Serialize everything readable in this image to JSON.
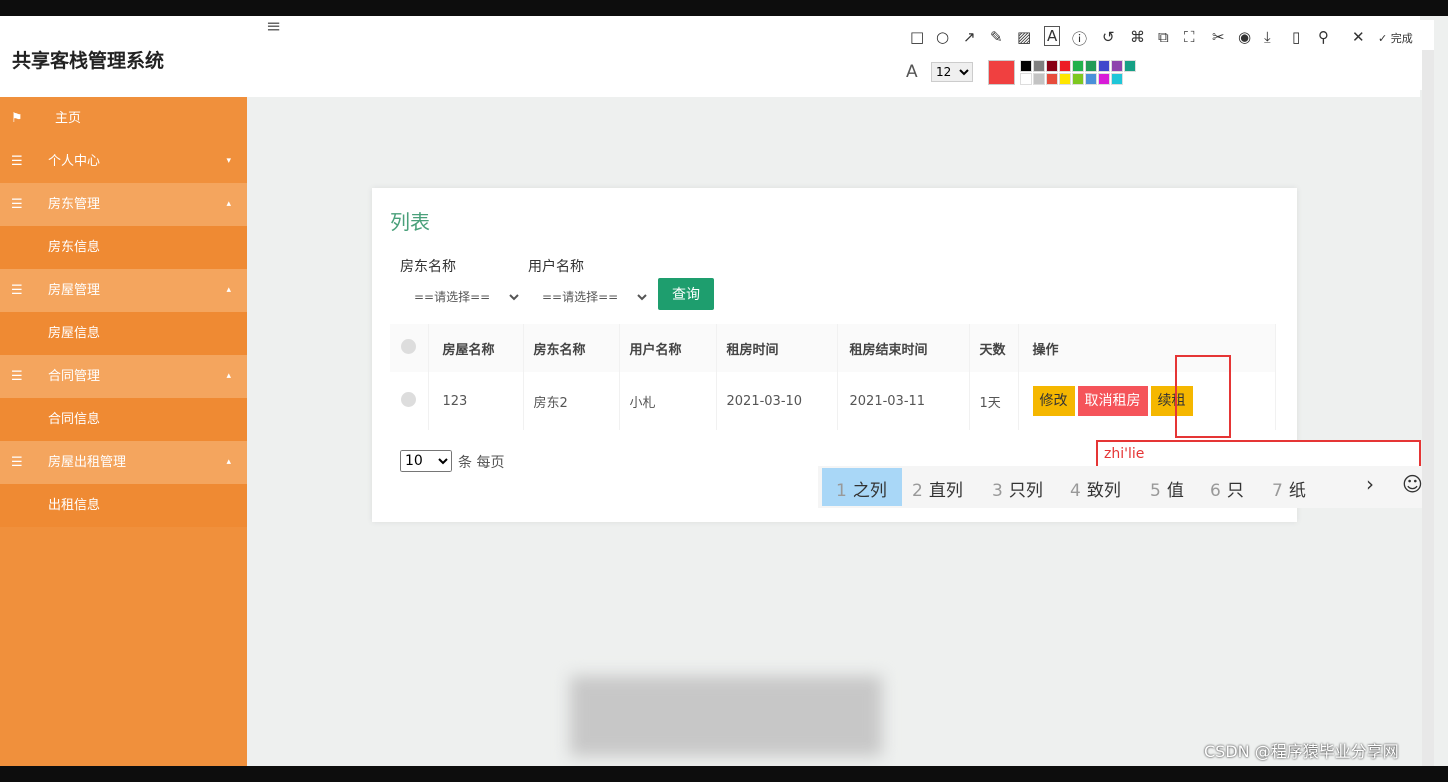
{
  "app": {
    "title": "共享客栈管理系统",
    "menu_toggle": "≡"
  },
  "sidebar": {
    "items": [
      {
        "icon": "⚑",
        "label": "主页",
        "caret": ""
      },
      {
        "icon": "☰",
        "label": "个人中心",
        "caret": "▾"
      },
      {
        "icon": "☰",
        "label": "房东管理",
        "caret": "▴"
      },
      {
        "icon": "",
        "label": "房东信息",
        "caret": ""
      },
      {
        "icon": "☰",
        "label": "房屋管理",
        "caret": "▴"
      },
      {
        "icon": "",
        "label": "房屋信息",
        "caret": ""
      },
      {
        "icon": "☰",
        "label": "合同管理",
        "caret": "▴"
      },
      {
        "icon": "",
        "label": "合同信息",
        "caret": ""
      },
      {
        "icon": "☰",
        "label": "房屋出租管理",
        "caret": "▴"
      },
      {
        "icon": "",
        "label": "出租信息",
        "caret": ""
      }
    ]
  },
  "list": {
    "title": "列表",
    "filters": {
      "landlord_label": "房东名称",
      "user_label": "用户名称",
      "landlord_value": "==请选择==",
      "user_value": "==请选择==",
      "query_button": "查询"
    },
    "table": {
      "headers": [
        "房屋名称",
        "房东名称",
        "用户名称",
        "租房时间",
        "租房结束时间",
        "天数",
        "操作"
      ],
      "row": {
        "house": "123",
        "landlord": "房东2",
        "user": "小札",
        "start": "2021-03-10",
        "end": "2021-03-11",
        "days": "1天"
      },
      "actions": {
        "edit": "修改",
        "cancel": "取消租房",
        "renew": "续租"
      }
    },
    "pager": {
      "size": "10",
      "per_page_text": "条 每页"
    }
  },
  "annotation": {
    "input_text": "zhi'lie"
  },
  "ime": {
    "candidates": [
      {
        "n": "1",
        "w": "之列"
      },
      {
        "n": "2",
        "w": "直列"
      },
      {
        "n": "3",
        "w": "只列"
      },
      {
        "n": "4",
        "w": "致列"
      },
      {
        "n": "5",
        "w": "值"
      },
      {
        "n": "6",
        "w": "只"
      },
      {
        "n": "7",
        "w": "纸"
      }
    ],
    "next_icon": "›",
    "emoji_icon": "☺"
  },
  "snip_toolbar": {
    "tools": [
      "□",
      "○",
      "↗",
      "✎",
      "▨",
      "A",
      "ⓘ",
      "↺",
      "⌘",
      "⧉",
      "⛶",
      "✂",
      "◉",
      "⤓",
      "▯",
      "⚲",
      "✕"
    ],
    "done_label": "✓ 完成",
    "font_icon": "A",
    "font_size": "12",
    "current_color": "#f04040",
    "palette": [
      "#000000",
      "#7f7f7f",
      "#880015",
      "#ed1c24",
      "#22b14c",
      "#239b56",
      "#3f48cc",
      "#8e44ad",
      "#16a085",
      "#ffffff",
      "#c3c3c3",
      "#e74c3c",
      "#ffe600",
      "#7ec820",
      "#4a90d9",
      "#d81bd8",
      "#1fc6d8"
    ]
  },
  "watermark": "CSDN @程序猿毕业分享网"
}
